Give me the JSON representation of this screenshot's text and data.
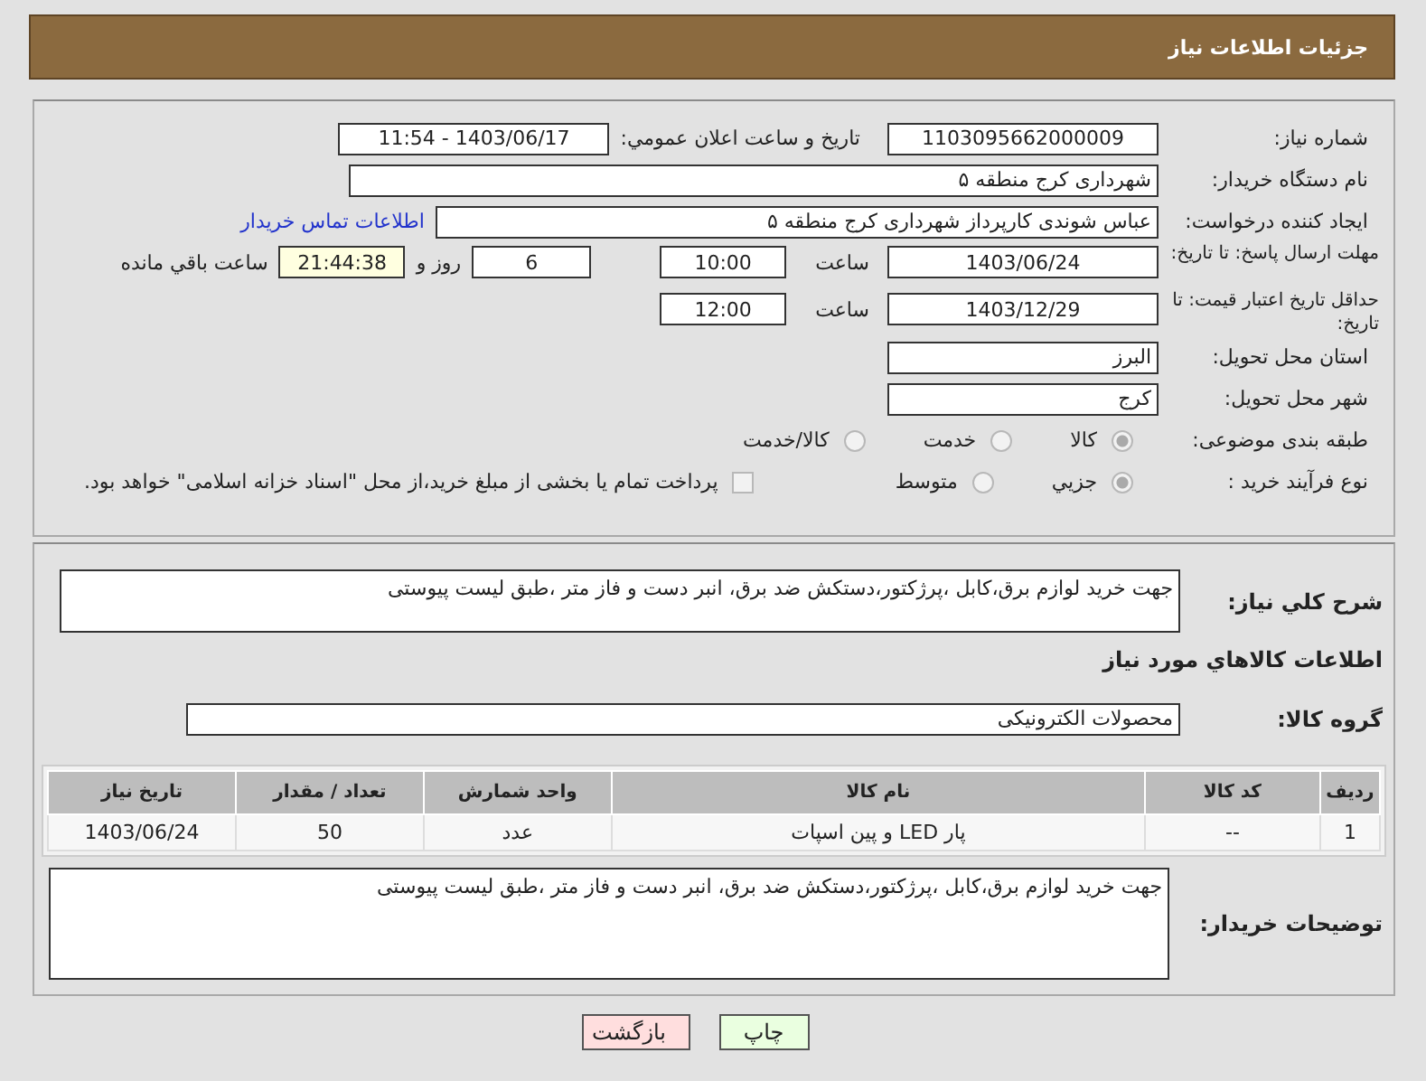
{
  "header": {
    "title": "جزئيات اطلاعات نياز"
  },
  "need_number": {
    "label": "شماره نياز:",
    "value": "1103095662000009"
  },
  "announce": {
    "label": "تاريخ و ساعت اعلان عمومي:",
    "value": "1403/06/17 - 11:54"
  },
  "buyer_org": {
    "label": "نام دستگاه خريدار:",
    "value": "شهرداری کرج منطقه ۵"
  },
  "creator": {
    "label": "ايجاد کننده درخواست:",
    "value": "عباس شوندی کارپرداز شهرداری کرج منطقه ۵",
    "link": "اطلاعات تماس خريدار"
  },
  "deadline": {
    "label": "مهلت ارسال پاسخ: تا تاريخ:",
    "date": "1403/06/24",
    "time_label": "ساعت",
    "time": "10:00",
    "days": "6",
    "days_label": "روز و",
    "remaining": "21:44:38",
    "remaining_label": "ساعت باقي مانده"
  },
  "validity": {
    "label": "حداقل تاريخ اعتبار قيمت: تا تاريخ:",
    "date": "1403/12/29",
    "time_label": "ساعت",
    "time": "12:00"
  },
  "province": {
    "label": "استان محل تحويل:",
    "value": "البرز"
  },
  "city": {
    "label": "شهر محل تحويل:",
    "value": "کرج"
  },
  "category": {
    "label": "طبقه بندی موضوعی:",
    "options": [
      {
        "label": "كالا",
        "selected": true
      },
      {
        "label": "خدمت",
        "selected": false
      },
      {
        "label": "كالا/خدمت",
        "selected": false
      }
    ]
  },
  "process": {
    "label": "نوع فرآيند خريد :",
    "options": [
      {
        "label": "جزيي",
        "selected": true
      },
      {
        "label": "متوسط",
        "selected": false
      }
    ],
    "payment": {
      "label": "پرداخت تمام يا بخشی از مبلغ خريد،از محل \"اسناد خزانه اسلامی\" خواهد بود.",
      "checked": false
    }
  },
  "description": {
    "label": "شرح كلي نياز:",
    "value": "جهت خرید لوازم برق،کابل ،پرژکتور،دستکش ضد برق، انبر دست و فاز متر ،طبق لیست پیوستی"
  },
  "items_heading": "اطلاعات كالاهاي مورد نياز",
  "goods_group": {
    "label": "گروه كالا:",
    "value": "محصولات الکترونیکی"
  },
  "table": {
    "columns": [
      "رديف",
      "کد کالا",
      "نام کالا",
      "واحد شمارش",
      "تعداد / مقدار",
      "تاريخ نياز"
    ],
    "rows": [
      [
        "1",
        "--",
        "پار LED و پین اسپات",
        "عدد",
        "50",
        "1403/06/24"
      ]
    ]
  },
  "buyer_notes": {
    "label": "توضيحات خريدار:",
    "value": "جهت خرید لوازم برق،کابل ،پرژکتور،دستکش ضد برق، انبر دست و فاز متر ،طبق لیست پیوستی"
  },
  "buttons": [
    {
      "label": "چاپ",
      "kind": "print"
    },
    {
      "label": "بازگشت",
      "kind": "back"
    }
  ]
}
